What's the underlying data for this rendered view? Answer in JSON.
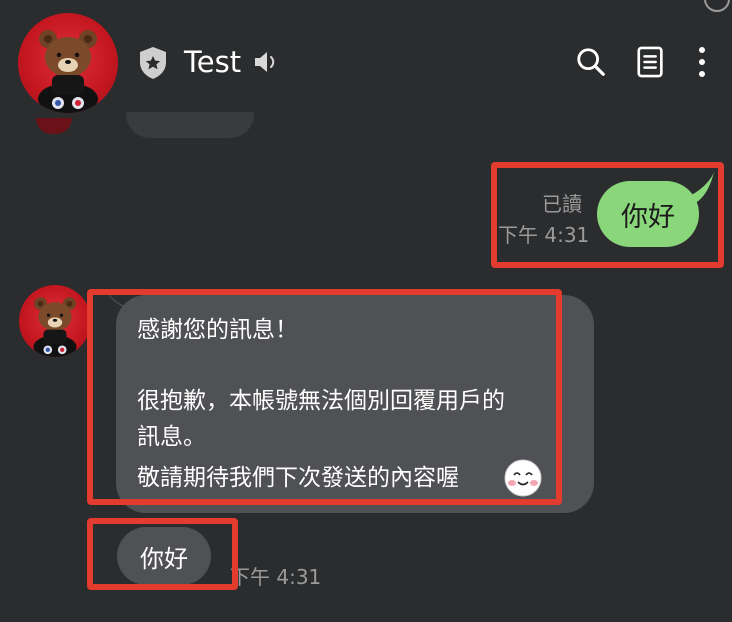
{
  "header": {
    "title": "Test",
    "icons": {
      "official": "shield-star-icon",
      "mute": "speaker-icon",
      "search": "search-icon",
      "notes": "notes-icon",
      "more": "more-vertical-icon"
    }
  },
  "messages": {
    "outgoing": {
      "text": "你好",
      "read_label": "已讀",
      "time": "下午 4:31"
    },
    "auto_reply": {
      "line1": "感謝您的訊息！",
      "line2": "很抱歉，本帳號無法個別回覆用戶的",
      "line3": "訊息。",
      "line4": "敬請期待我們下次發送的內容喔",
      "emoji": "smiling-face-emoji"
    },
    "incoming": {
      "text": "你好",
      "time": "下午 4:31"
    }
  },
  "colors": {
    "background": "#2b2c2e",
    "outgoing_bubble": "#8ad67a",
    "incoming_bubble": "#505154",
    "annotation": "#e33b2e",
    "meta_text": "#9a9a9a"
  }
}
